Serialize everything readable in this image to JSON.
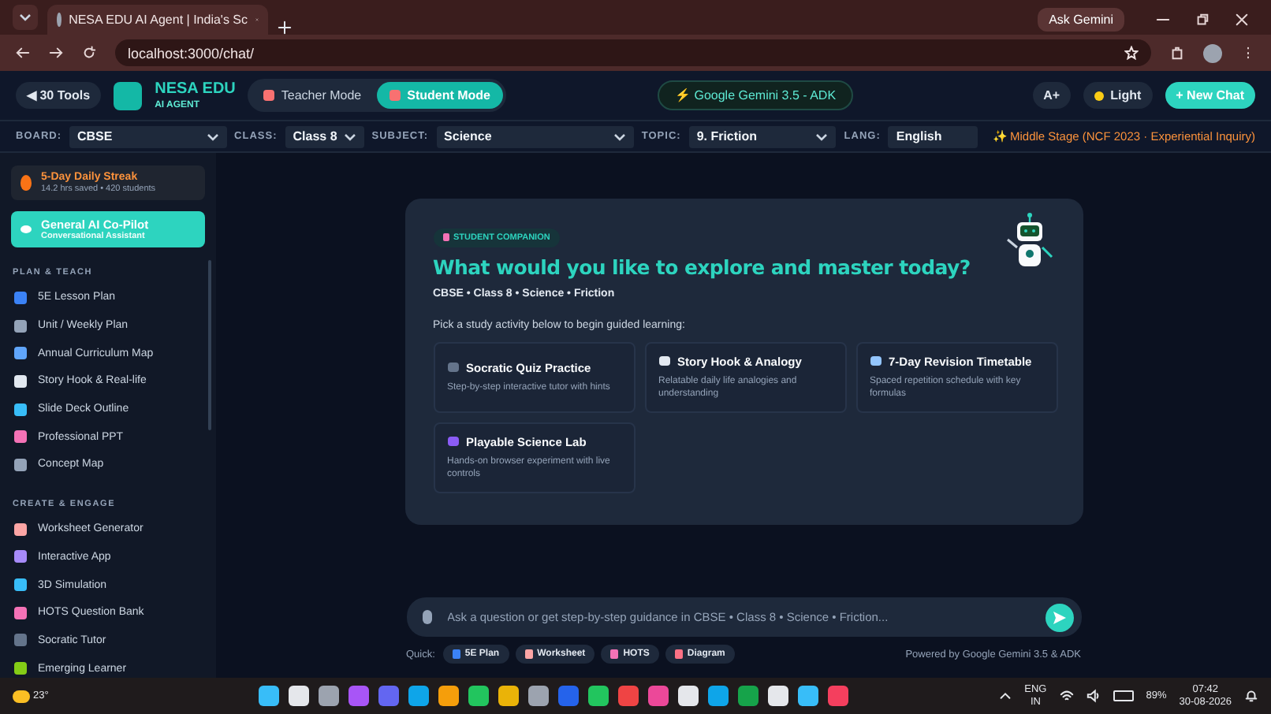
{
  "browser": {
    "tab_title": "NESA EDU AI Agent | India's Sc",
    "address": "localhost:3000/chat/",
    "ask_gemini": "Ask Gemini"
  },
  "header": {
    "tools_button": "◀ 30 Tools",
    "brand_name": "NESA EDU",
    "brand_sub": "AI AGENT",
    "modes": [
      {
        "label": "Teacher Mode",
        "selected": false
      },
      {
        "label": "Student Mode",
        "selected": true
      }
    ],
    "model_badge": "⚡ Google Gemini 3.5 - ADK",
    "font_button": "A+",
    "theme_button": "Light",
    "new_chat": "+ New Chat"
  },
  "filters": [
    {
      "label": "BOARD:",
      "value": "CBSE",
      "kind": "select"
    },
    {
      "label": "CLASS:",
      "value": "Class 8",
      "kind": "select"
    },
    {
      "label": "SUBJECT:",
      "value": "Science",
      "kind": "select"
    },
    {
      "label": "TOPIC:",
      "value": "9. Friction",
      "kind": "select"
    },
    {
      "label": "LANG:",
      "value": "English",
      "kind": "text"
    }
  ],
  "stage": "✨ Middle Stage (NCF 2023 · Experiential Inquiry)",
  "sidebar": {
    "streak": {
      "title": "5-Day Daily Streak",
      "subtitle": "14.2 hrs saved • 420 students"
    },
    "copilot": {
      "title": "General AI Co-Pilot",
      "subtitle": "Conversational Assistant",
      "selected": true
    },
    "sections": [
      {
        "title": "PLAN & TEACH",
        "items": [
          {
            "label": "5E Lesson Plan"
          },
          {
            "label": "Unit / Weekly Plan"
          },
          {
            "label": "Annual Curriculum Map"
          },
          {
            "label": "Story Hook & Real-life"
          },
          {
            "label": "Slide Deck Outline"
          },
          {
            "label": "Professional PPT"
          },
          {
            "label": "Concept Map"
          }
        ]
      },
      {
        "title": "CREATE & ENGAGE",
        "items": [
          {
            "label": "Worksheet Generator"
          },
          {
            "label": "Interactive App"
          },
          {
            "label": "3D Simulation"
          },
          {
            "label": "HOTS Question Bank"
          },
          {
            "label": "Socratic Tutor"
          },
          {
            "label": "Emerging Learner"
          }
        ]
      }
    ]
  },
  "welcome": {
    "badge": "STUDENT COMPANION",
    "heading": "What would you like to explore and master today?",
    "context": "CBSE • Class 8 • Science • Friction",
    "prompt": "Pick a study activity below to begin guided learning:",
    "activities": [
      {
        "title": "Socratic Quiz Practice",
        "description": "Step-by-step interactive tutor with hints"
      },
      {
        "title": "Story Hook & Analogy",
        "description": "Relatable daily life analogies and understanding"
      },
      {
        "title": "7-Day Revision Timetable",
        "description": "Spaced repetition schedule with key formulas"
      },
      {
        "title": "Playable Science Lab",
        "description": "Hands-on browser experiment with live controls"
      }
    ]
  },
  "composer": {
    "placeholder": "Ask a question or get step-by-step guidance in CBSE • Class 8 • Science • Friction...",
    "quick_label": "Quick:",
    "quick_chips": [
      "5E Plan",
      "Worksheet",
      "HOTS",
      "Diagram"
    ],
    "powered_by": "Powered by Google Gemini 3.5 & ADK"
  },
  "taskbar": {
    "weather": "23°",
    "lang": "ENG",
    "region": "IN",
    "battery": "89%",
    "time": "07:42",
    "date": "30-08-2026"
  }
}
